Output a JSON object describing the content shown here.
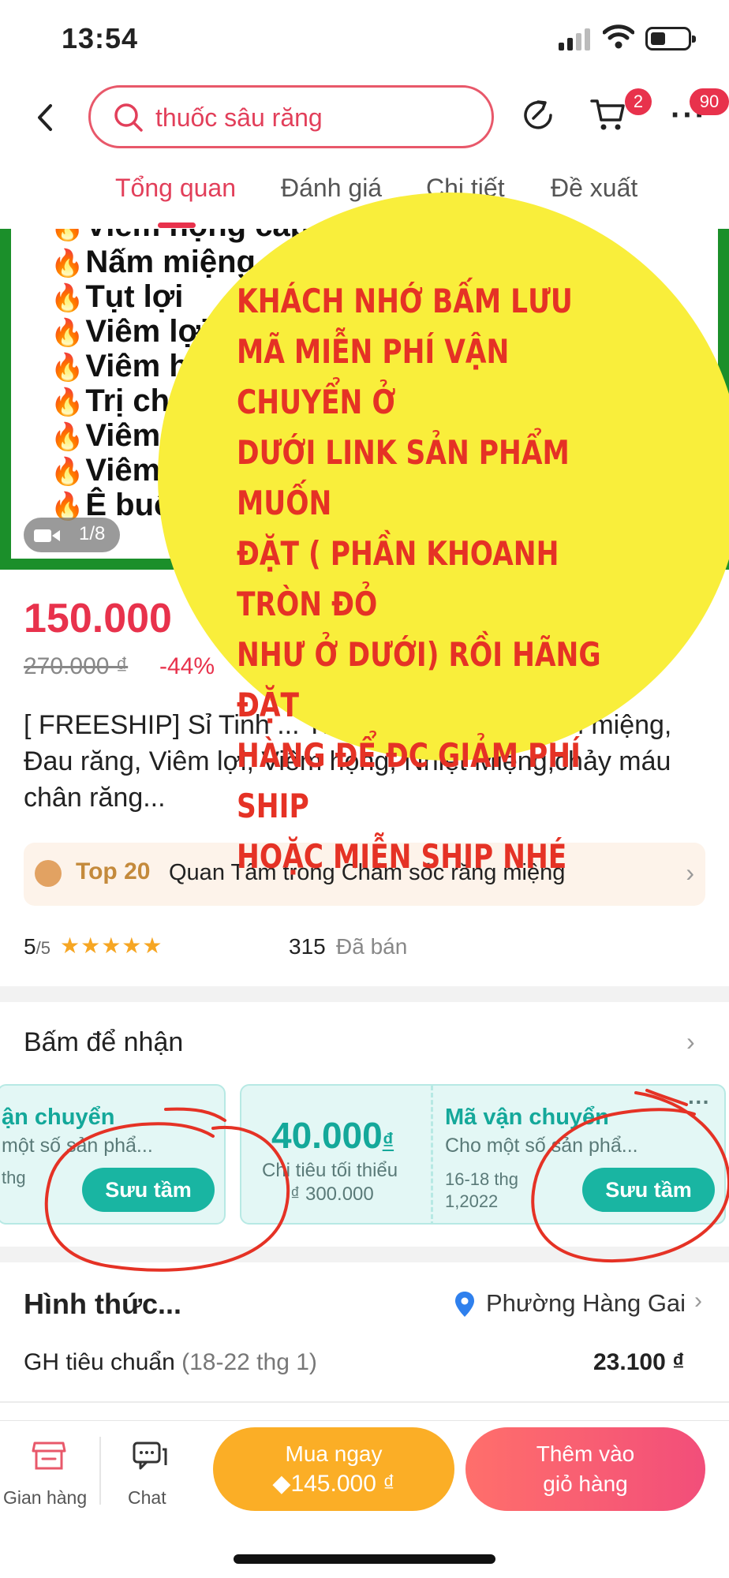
{
  "status_bar": {
    "time": "13:54"
  },
  "header": {
    "search_text": "thuốc sâu răng",
    "cart_badge": "2",
    "more_badge": "90"
  },
  "tabs": [
    {
      "label": "Tổng quan",
      "active": true
    },
    {
      "label": "Đánh giá",
      "active": false
    },
    {
      "label": "Chi tiết",
      "active": false
    },
    {
      "label": "Đề xuất",
      "active": false
    }
  ],
  "product_image": {
    "ailments": [
      "Viêm họng cấp t",
      "Nấm miệng",
      "Tụt lợi",
      "Viêm lợi t",
      "Viêm họ",
      "Trị chấ",
      "Viêm lư",
      "Viêm t",
      "Ê buốt"
    ],
    "counter": "1/8"
  },
  "product": {
    "price": "150.000",
    "old_price": "270.000 ₫",
    "discount": "-44%",
    "title": "[ FREESHIP] Sỉ Tinh ... Thảo Liên lọ 20ml - Hôi miệng, Đau răng, Viêm lợi, Viêm họng, Nhiệt Miệng,chảy máu chân răng..."
  },
  "ranking": {
    "rank": "Top 20",
    "text": "Quan Tâm trong Chăm sóc răng miệng"
  },
  "rating": {
    "score": "5",
    "out_of": "/5",
    "stars": "★★★★★",
    "sold_count": "315",
    "sold_label": "Đã bán"
  },
  "vouchers": {
    "title": "Bấm để nhận",
    "items": [
      {
        "title": "ận chuyển",
        "subtitle": "một số sản phẩ...",
        "small": "thg",
        "button": "Sưu tầm"
      },
      {
        "amount": "40.000",
        "currency": "₫",
        "min_label": "Chi tiêu tối thiểu",
        "min_value": "₫ 300.000"
      },
      {
        "title": "Mã vận chuyển",
        "subtitle": "Cho một số sản phẩ...",
        "date": "16-18 thg",
        "date2": "1,2022",
        "button": "Sưu tầm"
      }
    ]
  },
  "delivery": {
    "title": "Hình thức...",
    "location": "Phường Hàng Gai",
    "type": "GH tiêu chuẩn",
    "dates": "(18-22 thg 1)",
    "price": "23.100 ₫"
  },
  "bottom_bar": {
    "shop_label": "Gian hàng",
    "chat_label": "Chat",
    "buy_now_label": "Mua ngay",
    "buy_now_price": "145.000 ₫",
    "add_cart_label": "Thêm vào giỏ hàng"
  },
  "overlay_note": "KHÁCH NHỚ BẤM LƯU\nMÃ MIỄN PHÍ VẬN CHUYỂN Ở\nDƯỚI LINK SẢN PHẨM MUỐN\nĐẶT ( PHẦN KHOANH TRÒN ĐỎ\nNHƯ Ở DƯỚI) RỒI HÃNG ĐẶT\nHÀNG ĐỂ ĐC GIẢM PHÍ SHIP\nHOẶC MIỄN SHIP NHÉ",
  "colors": {
    "accent": "#e8324c",
    "voucher": "#19b5a2",
    "buy_now": "#fbae26",
    "overlay": "#f9ee3b",
    "annotation": "#e53225"
  }
}
